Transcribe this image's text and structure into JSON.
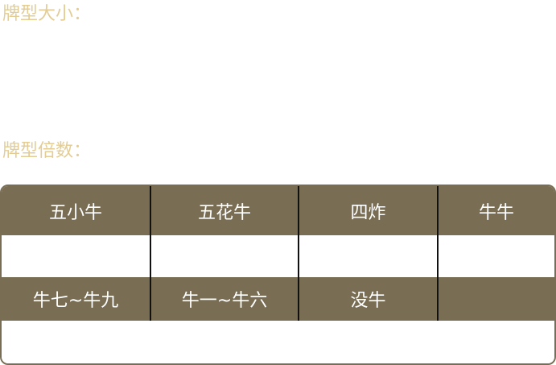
{
  "labels": {
    "card_size": "牌型大小：",
    "card_multiplier": "牌型倍数："
  },
  "multiplier_table": {
    "row1": {
      "headers": [
        "五小牛",
        "五花牛",
        "四炸",
        "牛牛"
      ],
      "values": [
        "",
        "",
        "",
        ""
      ]
    },
    "row2": {
      "headers": [
        "牛七~牛九",
        "牛一~牛六",
        "没牛",
        ""
      ],
      "values": [
        "",
        "",
        "",
        ""
      ]
    }
  },
  "colors": {
    "accent_gold": "#e3cd94",
    "header_brown": "#796d54",
    "cell_background": "#ffffff",
    "divider": "#111111"
  }
}
